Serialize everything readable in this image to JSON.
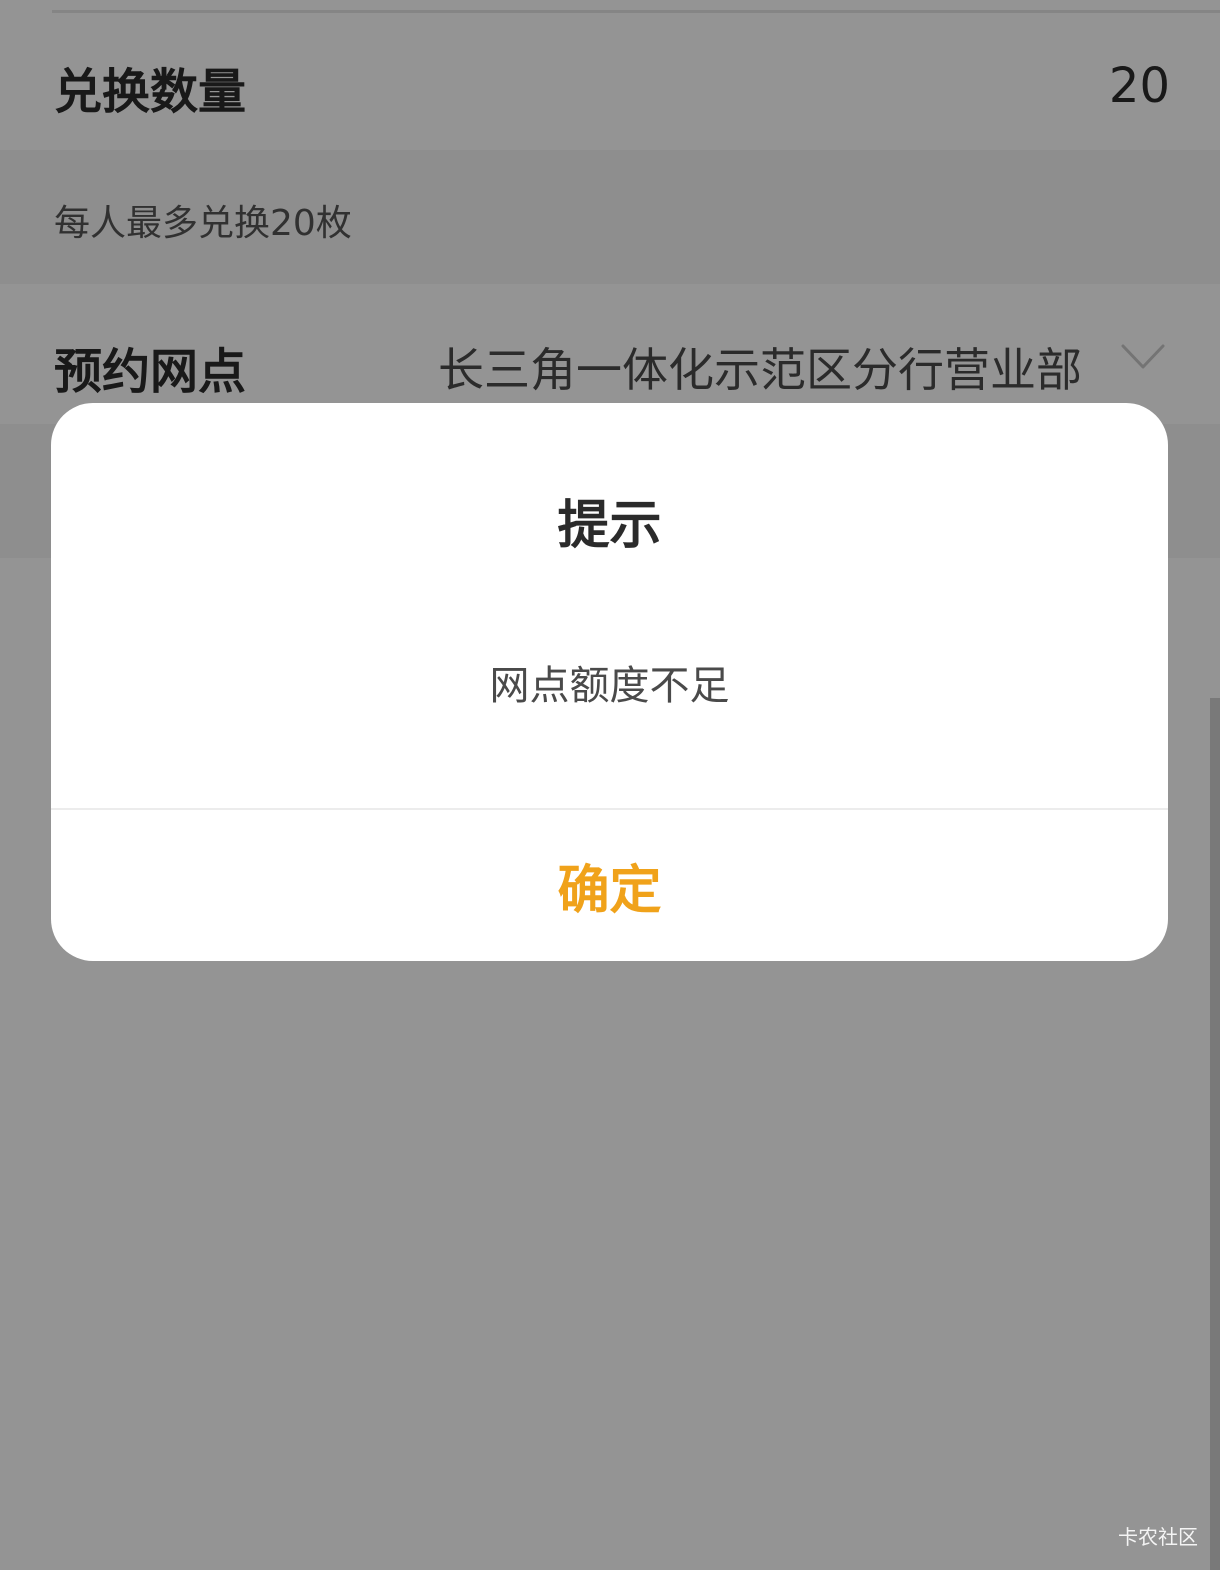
{
  "form": {
    "quantity_label": "兑换数量",
    "quantity_value": "20",
    "limit_note": "每人最多兑换20枚",
    "branch_label": "预约网点",
    "branch_value": "长三角一体化示范区分行营业部"
  },
  "dialog": {
    "title": "提示",
    "message": "网点额度不足",
    "confirm_label": "确定"
  },
  "watermark": "卡农社区",
  "colors": {
    "accent": "#f0a21a",
    "overlay": "#959595",
    "text_primary": "#2b2b2b"
  },
  "icons": {
    "branch_dropdown": "chevron-down-icon"
  }
}
